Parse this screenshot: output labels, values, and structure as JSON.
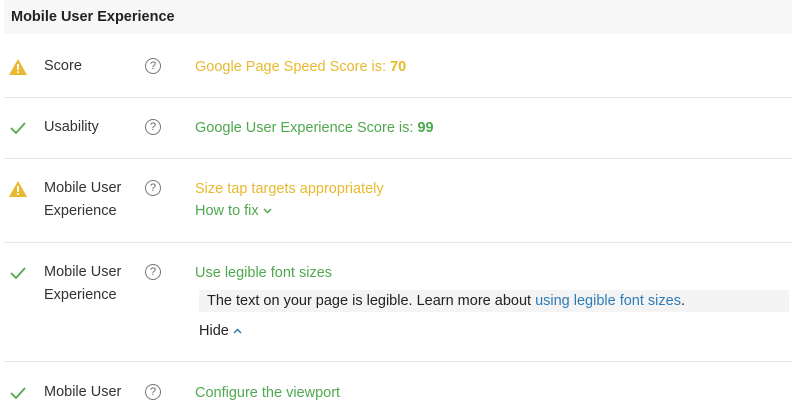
{
  "header": {
    "title": "Mobile User Experience"
  },
  "rows": [
    {
      "status": "warning",
      "icon": "warning-icon",
      "label": "Score",
      "help": "?",
      "text": "Google Page Speed Score is: ",
      "value": "70"
    },
    {
      "status": "pass",
      "icon": "check-icon",
      "label": "Usability",
      "help": "?",
      "text": "Google User Experience Score is: ",
      "value": "99"
    },
    {
      "status": "warning",
      "icon": "warning-icon",
      "label_line1": "Mobile User",
      "label_line2": "Experience",
      "help": "?",
      "text": "Size tap targets appropriately",
      "howto": "How to fix"
    },
    {
      "status": "pass",
      "icon": "check-icon",
      "label_line1": "Mobile User",
      "label_line2": "Experience",
      "help": "?",
      "text": "Use legible font sizes",
      "detail_text": "The text on your page is legible. Learn more about ",
      "detail_link": "using legible font sizes",
      "detail_end": ".",
      "hide": "Hide"
    },
    {
      "status": "pass",
      "icon": "check-icon",
      "label_line1": "Mobile User",
      "help": "?",
      "text": "Configure the viewport"
    }
  ],
  "colors": {
    "warning": "#e8b92e",
    "pass": "#4fa84f",
    "link": "#2e7cb8"
  }
}
